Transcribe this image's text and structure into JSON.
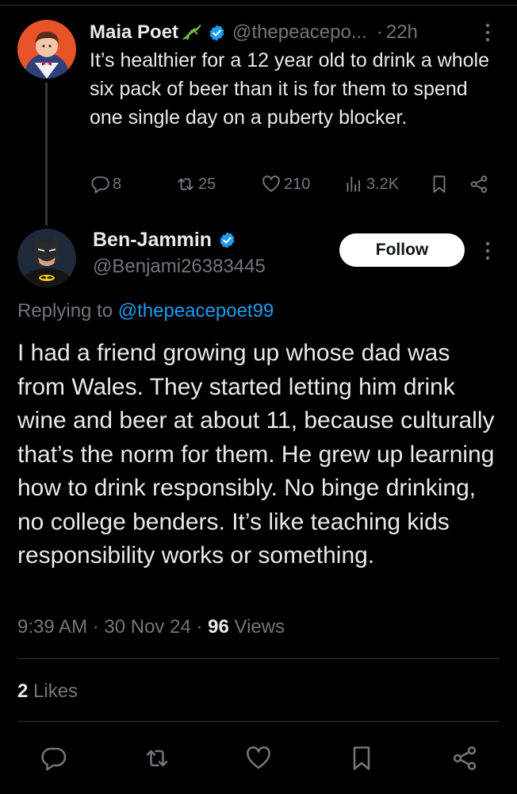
{
  "parent_tweet": {
    "author_name": "Maia Poet",
    "handle": "@thepeacepo...",
    "separator": "·",
    "time": "22h",
    "text": "It’s healthier for a 12 year old to drink a whole six pack of beer than it is for them to spend one single day on a puberty blocker.",
    "replies": "8",
    "reposts": "25",
    "likes": "210",
    "views": "3.2K",
    "icons": [
      "lizard-emoji-icon",
      "verified-badge-icon",
      "more-icon",
      "reply-icon",
      "repost-icon",
      "like-icon",
      "views-icon",
      "bookmark-icon",
      "share-icon"
    ]
  },
  "main_tweet": {
    "author_name": "Ben-Jammin",
    "handle": "@Benjami26383445",
    "follow_label": "Follow",
    "replying_prefix": "Replying to ",
    "replying_handle": "@thepeacepoet99",
    "text": "I had a friend growing up whose dad was from Wales.  They started letting him drink wine and beer at about 11, because culturally that’s the norm for them.  He grew up learning how to drink responsibly.  No binge drinking, no college benders.  It’s like teaching kids responsibility works or something.",
    "time": "9:39 AM",
    "sep1": " · ",
    "date": "30 Nov 24",
    "sep2": " · ",
    "views_count": "96",
    "views_label": " Views",
    "likes_count": "2",
    "likes_label": " Likes",
    "icons": [
      "verified-badge-icon",
      "more-icon",
      "reply-icon",
      "repost-icon",
      "like-icon",
      "bookmark-icon",
      "share-icon"
    ]
  },
  "colors": {
    "background": "#000000",
    "text": "#e7e9ea",
    "secondary": "#71767b",
    "link": "#1d9bf0",
    "verified": "#1d9bf0",
    "divider": "#2f3336",
    "follow_bg": "#ffffff"
  }
}
